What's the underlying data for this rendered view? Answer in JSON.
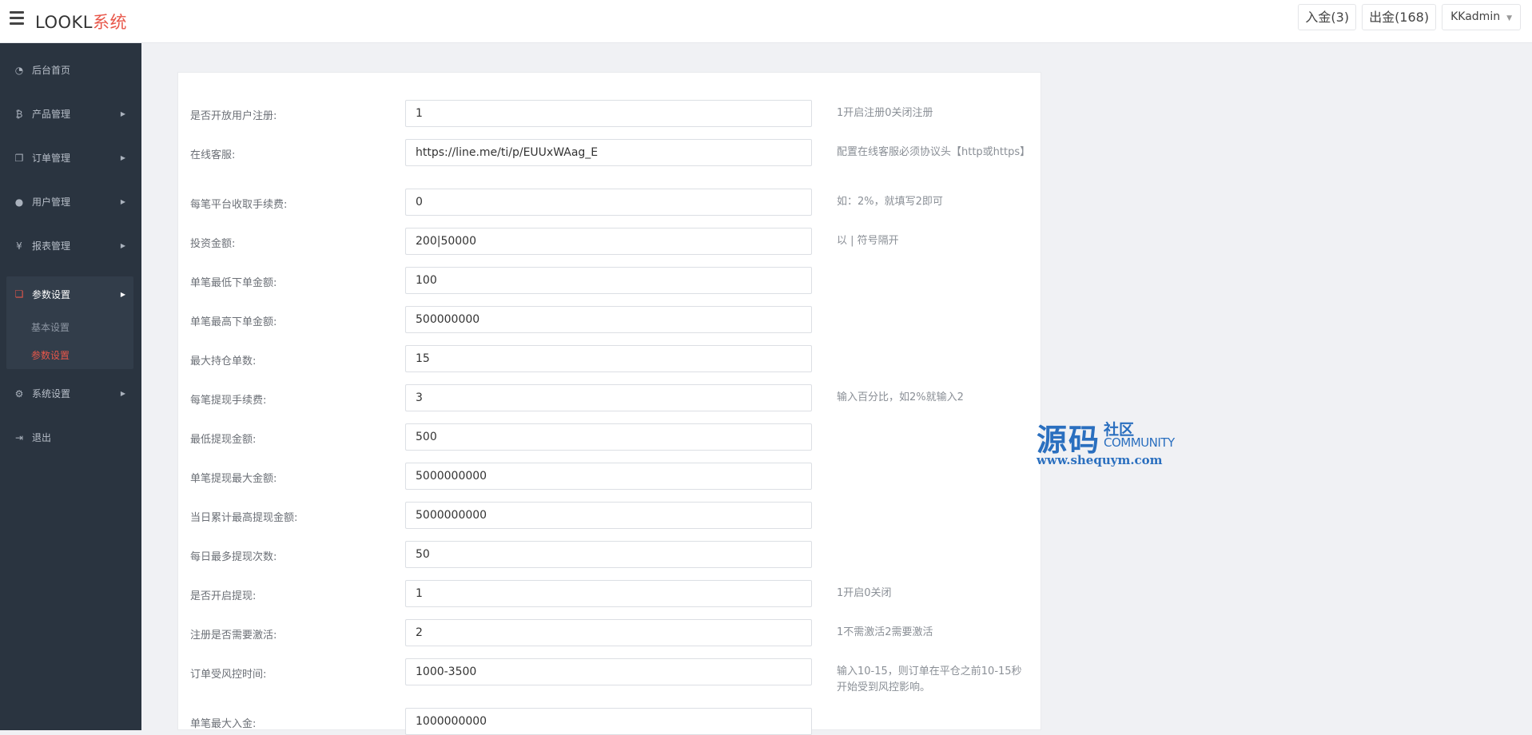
{
  "header": {
    "brand_main": "LOOKL",
    "brand_accent": "系统",
    "deposit_label": "入金(3)",
    "withdraw_label": "出金(168)",
    "user_label": "KKadmin",
    "accent_color": "#e8574a"
  },
  "sidebar": {
    "items": [
      {
        "label": "后台首页",
        "icon": "dashboard-icon"
      },
      {
        "label": "产品管理",
        "icon": "bitcoin-icon"
      },
      {
        "label": "订单管理",
        "icon": "copy-icon"
      },
      {
        "label": "用户管理",
        "icon": "user-icon"
      },
      {
        "label": "报表管理",
        "icon": "yen-icon"
      },
      {
        "label": "参数设置",
        "icon": "files-icon"
      },
      {
        "label": "系统设置",
        "icon": "gears-icon"
      },
      {
        "label": "退出",
        "icon": "sign-out-icon"
      }
    ],
    "submenu": [
      {
        "label": "基本设置"
      },
      {
        "label": "参数设置"
      }
    ]
  },
  "form": {
    "rows": [
      {
        "label": "是否开放用户注册:",
        "value": "1",
        "hint": "1开启注册0关闭注册"
      },
      {
        "label": "在线客服:",
        "value": "https://line.me/ti/p/EUUxWAag_E",
        "hint": "配置在线客服必须协议头【http或https】"
      },
      {
        "label": "每笔平台收取手续费:",
        "value": "0",
        "hint": "如：2%，就填写2即可"
      },
      {
        "label": "投资金额:",
        "value": "200|50000",
        "hint": "以 | 符号隔开"
      },
      {
        "label": "单笔最低下单金额:",
        "value": "100",
        "hint": ""
      },
      {
        "label": "单笔最高下单金额:",
        "value": "500000000",
        "hint": ""
      },
      {
        "label": "最大持仓单数:",
        "value": "15",
        "hint": ""
      },
      {
        "label": "每笔提现手续费:",
        "value": "3",
        "hint": "输入百分比，如2%就输入2"
      },
      {
        "label": "最低提现金额:",
        "value": "500",
        "hint": ""
      },
      {
        "label": "单笔提现最大金额:",
        "value": "5000000000",
        "hint": ""
      },
      {
        "label": "当日累计最高提现金额:",
        "value": "5000000000",
        "hint": ""
      },
      {
        "label": "每日最多提现次数:",
        "value": "50",
        "hint": ""
      },
      {
        "label": "是否开启提现:",
        "value": "1",
        "hint": "1开启0关闭"
      },
      {
        "label": "注册是否需要激活:",
        "value": "2",
        "hint": "1不需激活2需要激活"
      },
      {
        "label": "订单受风控时间:",
        "value": "1000-3500",
        "hint": "输入10-15，则订单在平仓之前10-15秒开始受到风控影响。"
      },
      {
        "label": "单笔最大入金:",
        "value": "1000000000",
        "hint": ""
      }
    ]
  },
  "watermark": {
    "big": "源码",
    "small": "社区",
    "community": "COMMUNITY",
    "url": "www.shequym.com"
  }
}
